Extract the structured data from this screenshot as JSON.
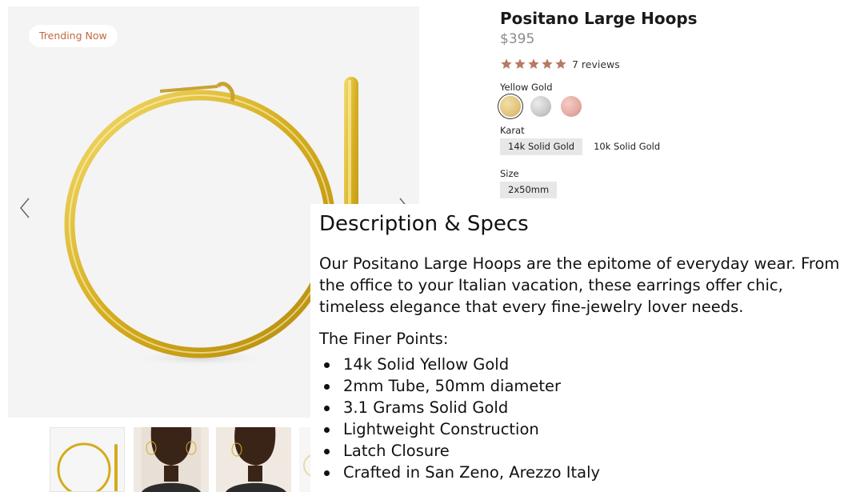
{
  "gallery": {
    "badge": "Trending Now",
    "prev_icon": "chevron-left-icon",
    "next_icon": "chevron-right-icon",
    "thumbnails": [
      "hoop-product-thumb",
      "model-front-thumb",
      "model-angle-thumb",
      "partial-thumb"
    ]
  },
  "product": {
    "title": "Positano Large Hoops",
    "price": "$395",
    "rating": 5,
    "reviews": "7 reviews",
    "metal_label": "Yellow Gold",
    "metals": [
      {
        "name": "yellow-gold",
        "color": "#e2c47c",
        "selected": true
      },
      {
        "name": "white-gold",
        "color": "#c9c9c9",
        "selected": false
      },
      {
        "name": "rose-gold",
        "color": "#e4aaa2",
        "selected": false
      }
    ],
    "karat_label": "Karat",
    "karat_options": [
      "14k Solid Gold",
      "10k Solid Gold"
    ],
    "size_label": "Size",
    "size_options": [
      "2x50mm"
    ]
  },
  "description": {
    "heading": "Description & Specs",
    "body": "Our Positano Large Hoops are the epitome of everyday wear. From the office to your Italian vacation, these earrings offer chic, timeless elegance that every fine-jewelry lover needs.",
    "finer_title": "The Finer Points:",
    "points": [
      "14k Solid Yellow Gold",
      "2mm Tube, 50mm diameter",
      "3.1 Grams Solid Gold",
      "Lightweight Construction",
      "Latch Closure",
      "Crafted in San Zeno, Arezzo Italy"
    ]
  },
  "colors": {
    "accent": "#c0673e",
    "star": "#b87a63",
    "gold": "#d9b53a"
  }
}
